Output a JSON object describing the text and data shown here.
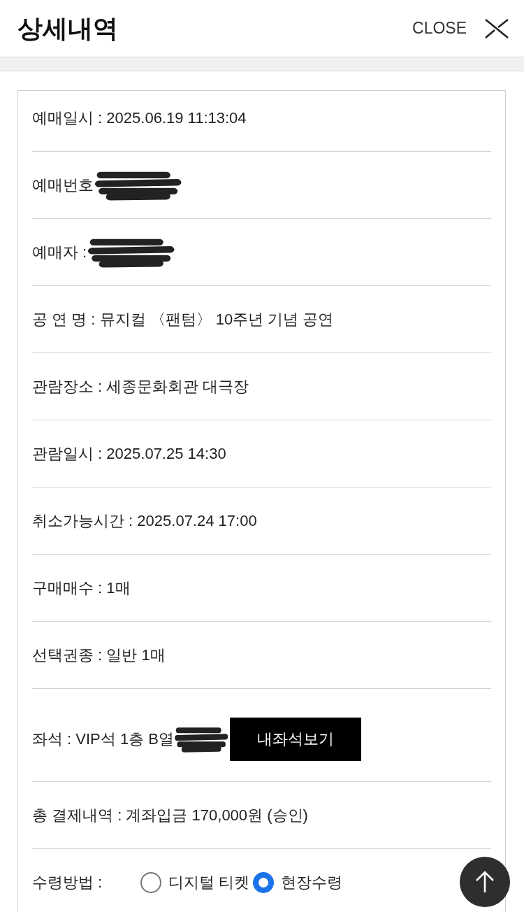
{
  "header": {
    "title": "상세내역",
    "close_label": "CLOSE"
  },
  "details": [
    {
      "kind": "text",
      "text": "예매일시 : 2025.06.19 11:13:04"
    },
    {
      "kind": "text",
      "text": "예매번호",
      "redacted": true
    },
    {
      "kind": "text",
      "text": "예매자 :",
      "redacted": true
    },
    {
      "kind": "text",
      "text": "공 연 명 : 뮤지컬 〈팬텀〉 10주년 기념 공연"
    },
    {
      "kind": "text",
      "text": "관람장소 : 세종문화회관 대극장"
    },
    {
      "kind": "text",
      "text": "관람일시 : 2025.07.25 14:30"
    },
    {
      "kind": "text",
      "text": "취소가능시간 : 2025.07.24 17:00"
    },
    {
      "kind": "text",
      "text": "구매매수 : 1매"
    },
    {
      "kind": "text",
      "text": "선택권종 : 일반 1매"
    },
    {
      "kind": "seat",
      "text": "좌석 : VIP석 1층 B열",
      "redacted": true,
      "button": "내좌석보기"
    },
    {
      "kind": "text",
      "text": "총 결제내역 : 계좌입금 170,000원 (승인)"
    },
    {
      "kind": "radio",
      "label": "수령방법 :",
      "options": [
        {
          "label": "디지털 티켓",
          "selected": false
        },
        {
          "label": "현장수령",
          "selected": true
        }
      ]
    }
  ]
}
